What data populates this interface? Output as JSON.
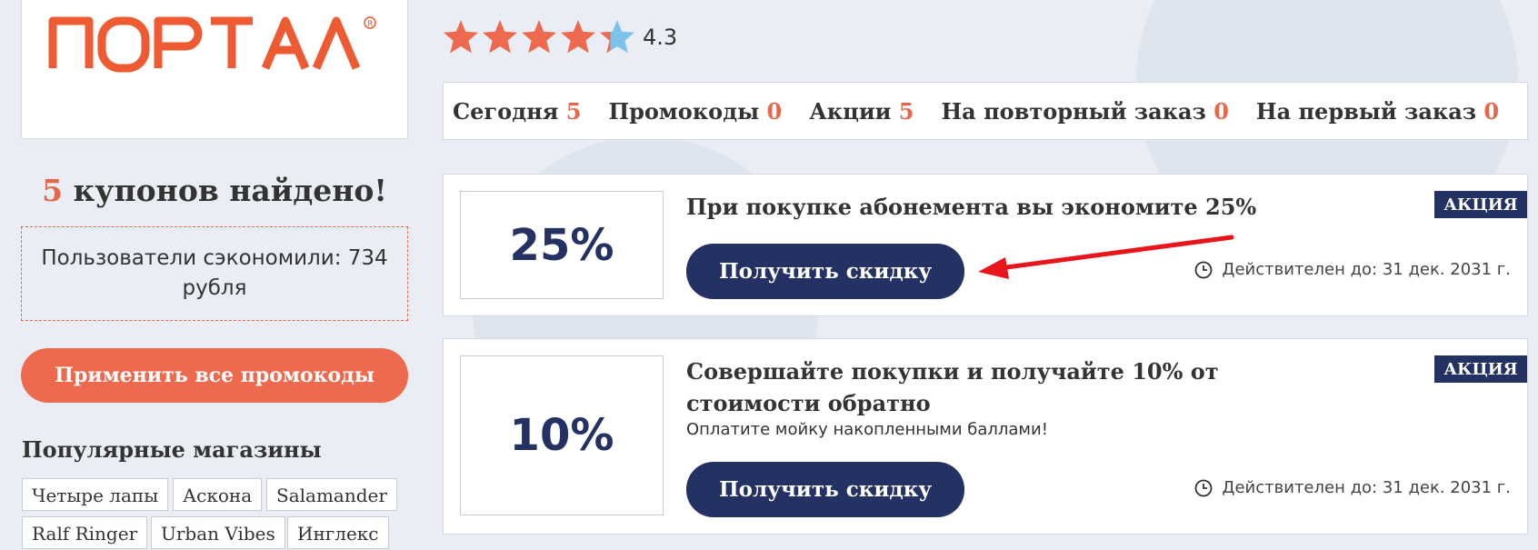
{
  "logo": {
    "text": "ПОРТАЛ",
    "color": "#ee5a32"
  },
  "rating": {
    "value": "4.3",
    "stars": 4.3,
    "max": 5,
    "filled_color": "#ee6a4e",
    "empty_color": "#7cc3ec"
  },
  "tabs": [
    {
      "label": "Сегодня",
      "count": "5"
    },
    {
      "label": "Промокоды",
      "count": "0"
    },
    {
      "label": "Акции",
      "count": "5"
    },
    {
      "label": "На повторный заказ",
      "count": "0"
    },
    {
      "label": "На первый заказ",
      "count": "0"
    }
  ],
  "sidebar": {
    "found_count": "5",
    "found_text": "купонов найдено!",
    "saved_text": "Пользователи сэкономили: 734 рубля",
    "apply_all_label": "Применить все промокоды",
    "popular_title": "Популярные магазины",
    "stores": [
      "Четыре лапы",
      "Аскона",
      "Salamander",
      "Ralf Ringer",
      "Urban Vibes",
      "Инглекс"
    ]
  },
  "coupons": [
    {
      "discount": "25%",
      "title": "При покупке абонемента вы экономите 25%",
      "description": "",
      "button_label": "Получить скидку",
      "badge": "АКЦИЯ",
      "valid_until": "Действителен до: 31 дек. 2031 г.",
      "clock_icon": "clock-icon"
    },
    {
      "discount": "10%",
      "title": "Совершайте покупки и получайте 10% от стоимости обратно",
      "description": "Оплатите мойку накопленными баллами!",
      "button_label": "Получить скидку",
      "badge": "АКЦИЯ",
      "valid_until": "Действителен до: 31 дек. 2031 г.",
      "clock_icon": "clock-icon"
    }
  ],
  "colors": {
    "accent": "#ee6a4e",
    "navy": "#233262",
    "annotation_arrow": "#e8151c"
  }
}
